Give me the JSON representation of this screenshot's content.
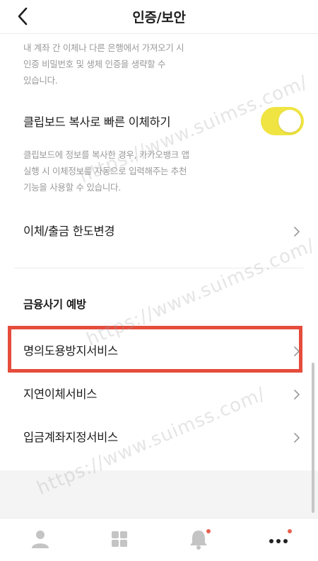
{
  "header": {
    "title": "인증/보안",
    "back_icon": "chevron-left-icon"
  },
  "auth_description": {
    "lines": [
      "내 계좌 간 이체나 다른 은행에서 가져오기 시",
      "인증 비밀번호 및 생체 인증을 생략할 수",
      "있습니다."
    ]
  },
  "clipboard_transfer": {
    "label": "클립보드 복사로 빠른 이체하기",
    "enabled": true,
    "toggle_color": "#f0e442",
    "description_lines": [
      "클립보드에 정보를 복사한 경우, 카카오뱅크 앱",
      "실행 시 이체정보를 자동으로 입력해주는 추천",
      "기능을 사용할 수 있습니다."
    ]
  },
  "limit_change": {
    "label": "이체/출금 한도변경"
  },
  "fraud_prevention": {
    "section_title": "금융사기 예방",
    "items": [
      {
        "label": "명의도용방지서비스",
        "highlighted": true
      },
      {
        "label": "지연이체서비스"
      },
      {
        "label": "입금계좌지정서비스"
      }
    ],
    "highlight_color": "#e54c3c"
  },
  "watermark": {
    "text": "https://www.suimss.com/"
  },
  "tabbar": {
    "tabs": [
      {
        "icon": "person-icon",
        "badge": false
      },
      {
        "icon": "grid-icon",
        "badge": false
      },
      {
        "icon": "bell-icon",
        "badge": true
      },
      {
        "icon": "more-dots-icon",
        "badge": true
      }
    ],
    "badge_color": "#e8604f"
  }
}
